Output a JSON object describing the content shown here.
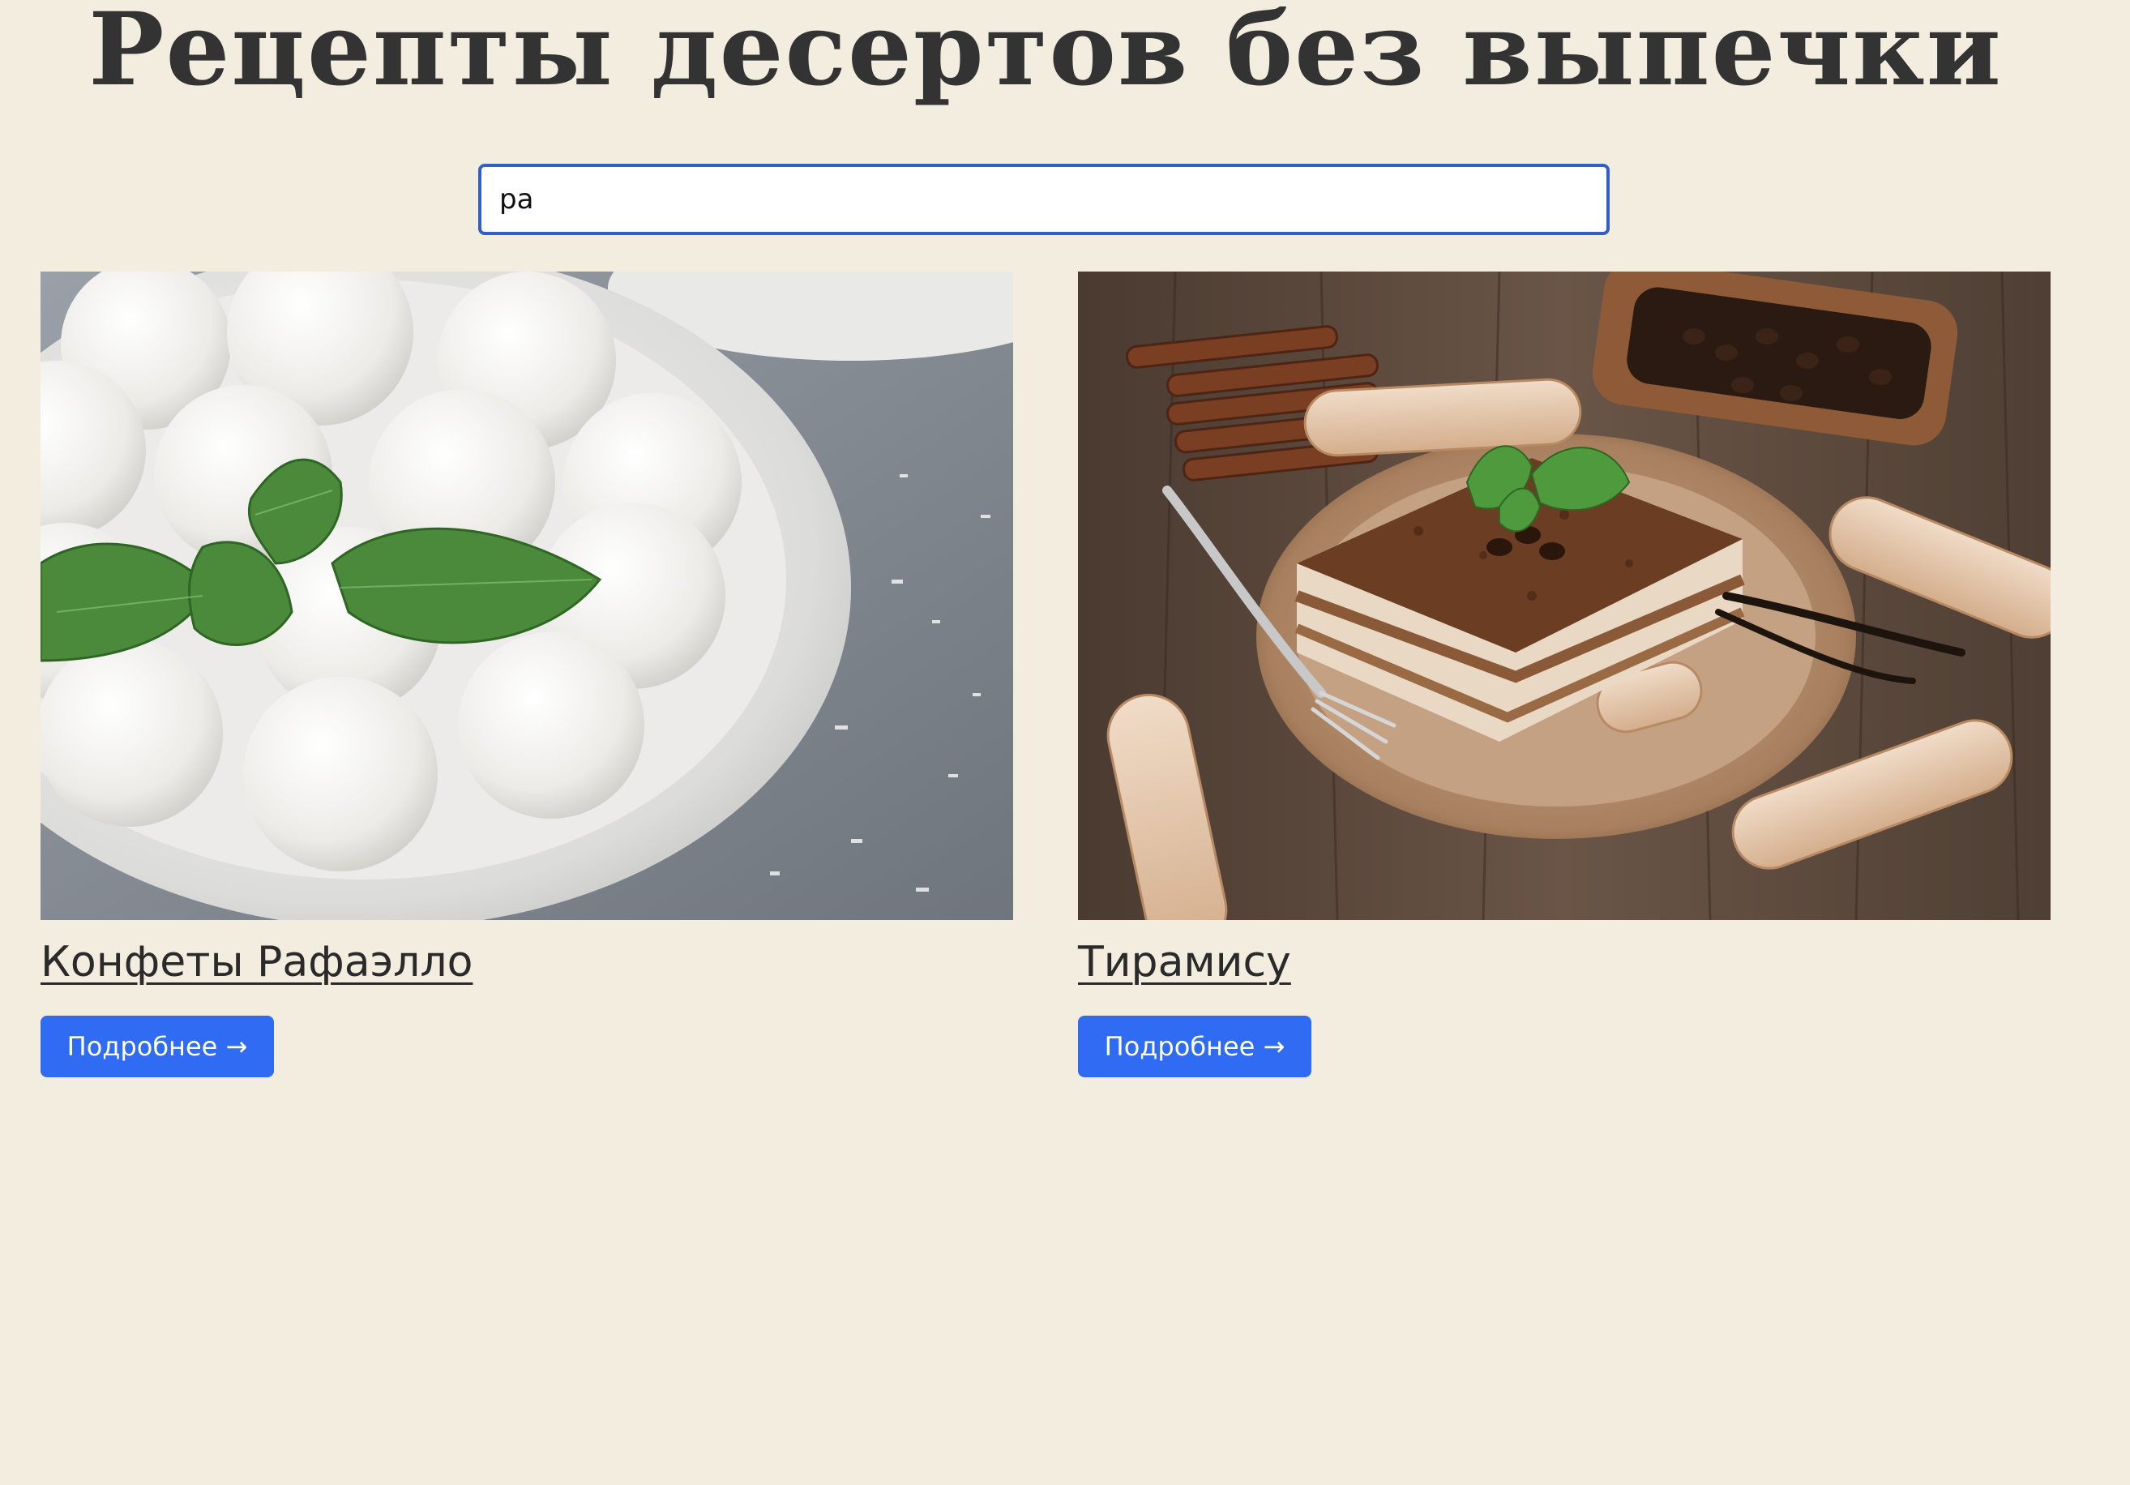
{
  "page": {
    "title": "Рецепты десертов без выпечки"
  },
  "search": {
    "value": "ра"
  },
  "recipes": [
    {
      "title": "Конфеты Рафаэлло",
      "button_label": "Подробнее →",
      "image": "coconut-candies-photo"
    },
    {
      "title": "Тирамису",
      "button_label": "Подробнее →",
      "image": "tiramisu-photo"
    }
  ],
  "colors": {
    "background": "#f3ede0",
    "accent": "#2f6bf3",
    "search_border": "#2f5fc7"
  }
}
